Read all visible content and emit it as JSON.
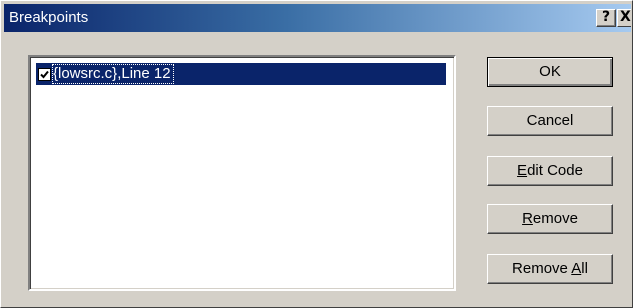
{
  "window": {
    "title": "Breakpoints",
    "help_label": "?",
    "close_label": "X"
  },
  "breakpoints": {
    "items": [
      {
        "label": "{lowsrc.c},Line 12",
        "checked": true,
        "selected": true
      }
    ]
  },
  "buttons": {
    "ok": "OK",
    "cancel": "Cancel",
    "edit_code": {
      "mnemonic": "E",
      "rest": "dit Code"
    },
    "remove": {
      "mnemonic": "R",
      "rest": "emove"
    },
    "remove_all": {
      "prefix": "Remove ",
      "mnemonic": "A",
      "rest": "ll"
    }
  },
  "colors": {
    "face": "#d4d0c8",
    "titlebar_start": "#0a246a",
    "titlebar_end": "#a6caf0",
    "selection": "#0a246a"
  }
}
